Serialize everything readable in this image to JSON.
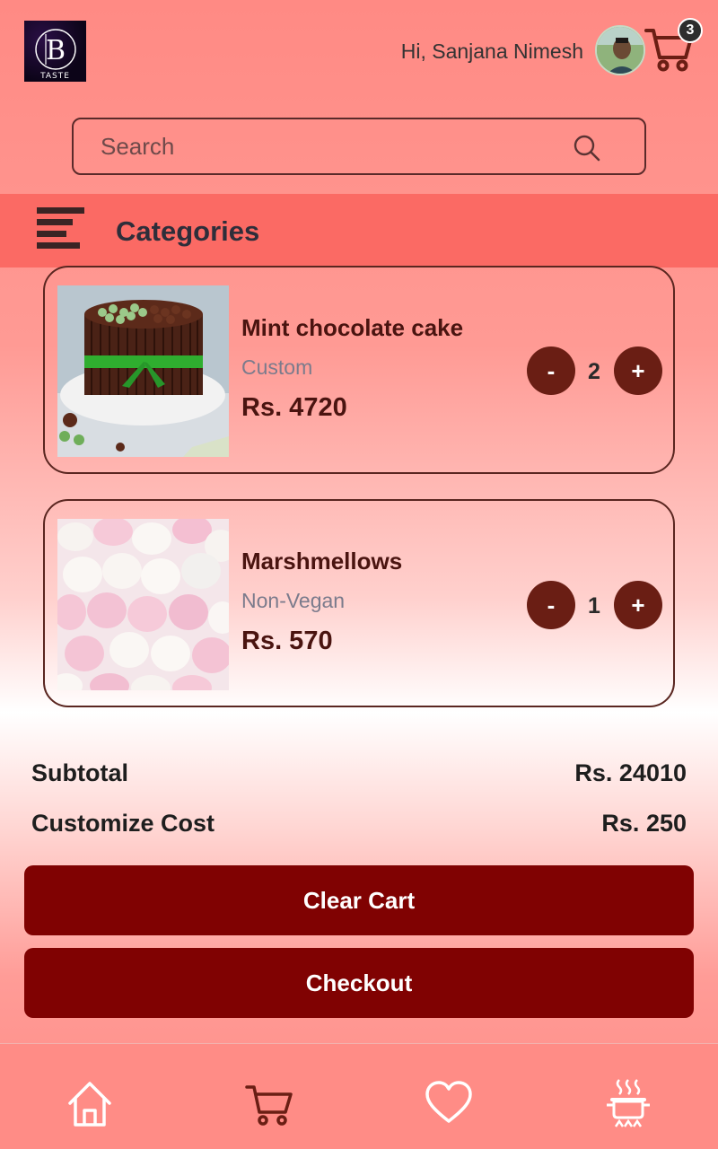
{
  "header": {
    "logo_text": "TASTE",
    "greeting": "Hi, Sanjana Nimesh",
    "cart_count": "3"
  },
  "search": {
    "placeholder": "Search"
  },
  "categories": {
    "label": "Categories"
  },
  "cart_items": [
    {
      "name": "Mint chocolate cake",
      "type": "Custom",
      "price": "Rs. 4720",
      "quantity": "2",
      "image": "mint-chocolate-cake-image"
    },
    {
      "name": "Marshmellows",
      "type": "Non-Vegan",
      "price": "Rs. 570",
      "quantity": "1",
      "image": "marshmallows-image"
    }
  ],
  "summary": {
    "subtotal_label": "Subtotal",
    "subtotal_value": "Rs. 24010",
    "customize_label": "Customize Cost",
    "customize_value": "Rs. 250"
  },
  "actions": {
    "clear_label": "Clear Cart",
    "checkout_label": "Checkout",
    "decrease_symbol": "-",
    "increase_symbol": "+"
  },
  "nav": {
    "items": [
      "home-icon",
      "cart-icon",
      "heart-icon",
      "cooking-pot-icon"
    ]
  },
  "colors": {
    "primary_button": "#800202",
    "qty_button": "#6a1e14",
    "category_bar": "#fb6a64"
  }
}
